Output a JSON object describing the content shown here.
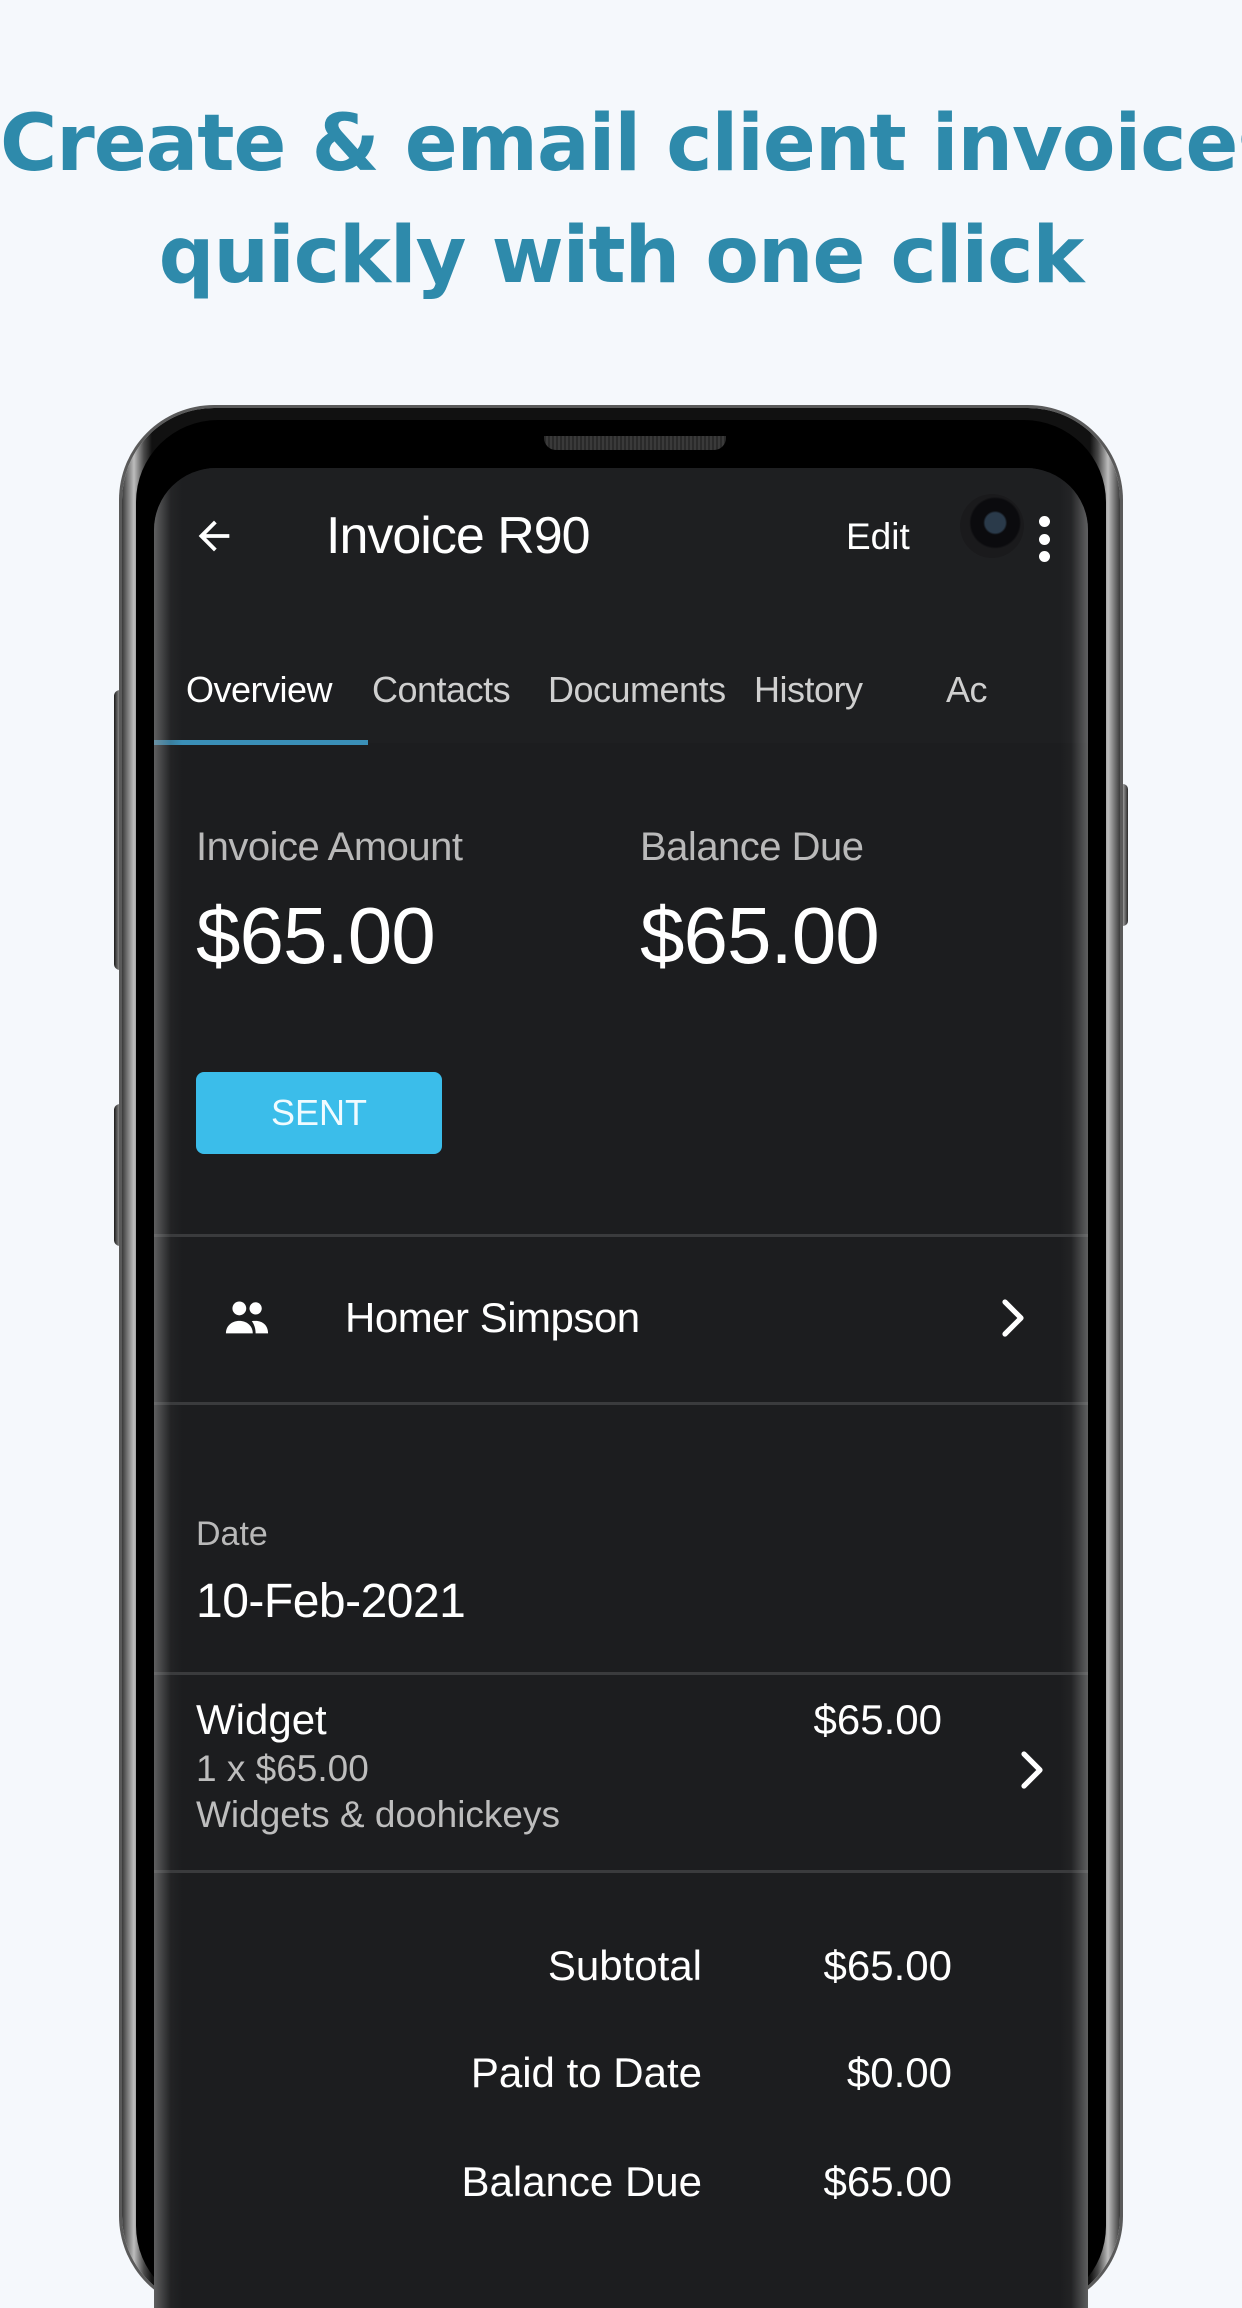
{
  "headline": {
    "line1": "Create & email client invoices",
    "line2": "quickly with one click"
  },
  "app_bar": {
    "back_icon": "arrow-left-icon",
    "title": "Invoice R90",
    "edit_label": "Edit",
    "menu_icon": "more-vertical-icon"
  },
  "tabs": [
    {
      "label": "Overview",
      "active": true
    },
    {
      "label": "Contacts",
      "active": false
    },
    {
      "label": "Documents",
      "active": false
    },
    {
      "label": "History",
      "active": false
    },
    {
      "label": "Activity",
      "visible_text": "Ac",
      "active": false
    }
  ],
  "summary": {
    "invoice_amount_label": "Invoice Amount",
    "invoice_amount_value": "$65.00",
    "balance_due_label": "Balance Due",
    "balance_due_value": "$65.00",
    "status": "SENT",
    "status_color": "#3bbdea"
  },
  "client": {
    "icon": "people-icon",
    "name": "Homer Simpson"
  },
  "date": {
    "label": "Date",
    "value": "10-Feb-2021"
  },
  "line_items": [
    {
      "name": "Widget",
      "quantity_price": "1 x $65.00",
      "description": "Widgets & doohickeys",
      "amount": "$65.00"
    }
  ],
  "totals": [
    {
      "label": "Subtotal",
      "value": "$65.00"
    },
    {
      "label": "Paid to Date",
      "value": "$0.00"
    },
    {
      "label": "Balance Due",
      "value": "$65.00"
    }
  ],
  "colors": {
    "headline": "#2e8aab",
    "accent": "#3a8fb7",
    "background": "#1c1d1f"
  }
}
